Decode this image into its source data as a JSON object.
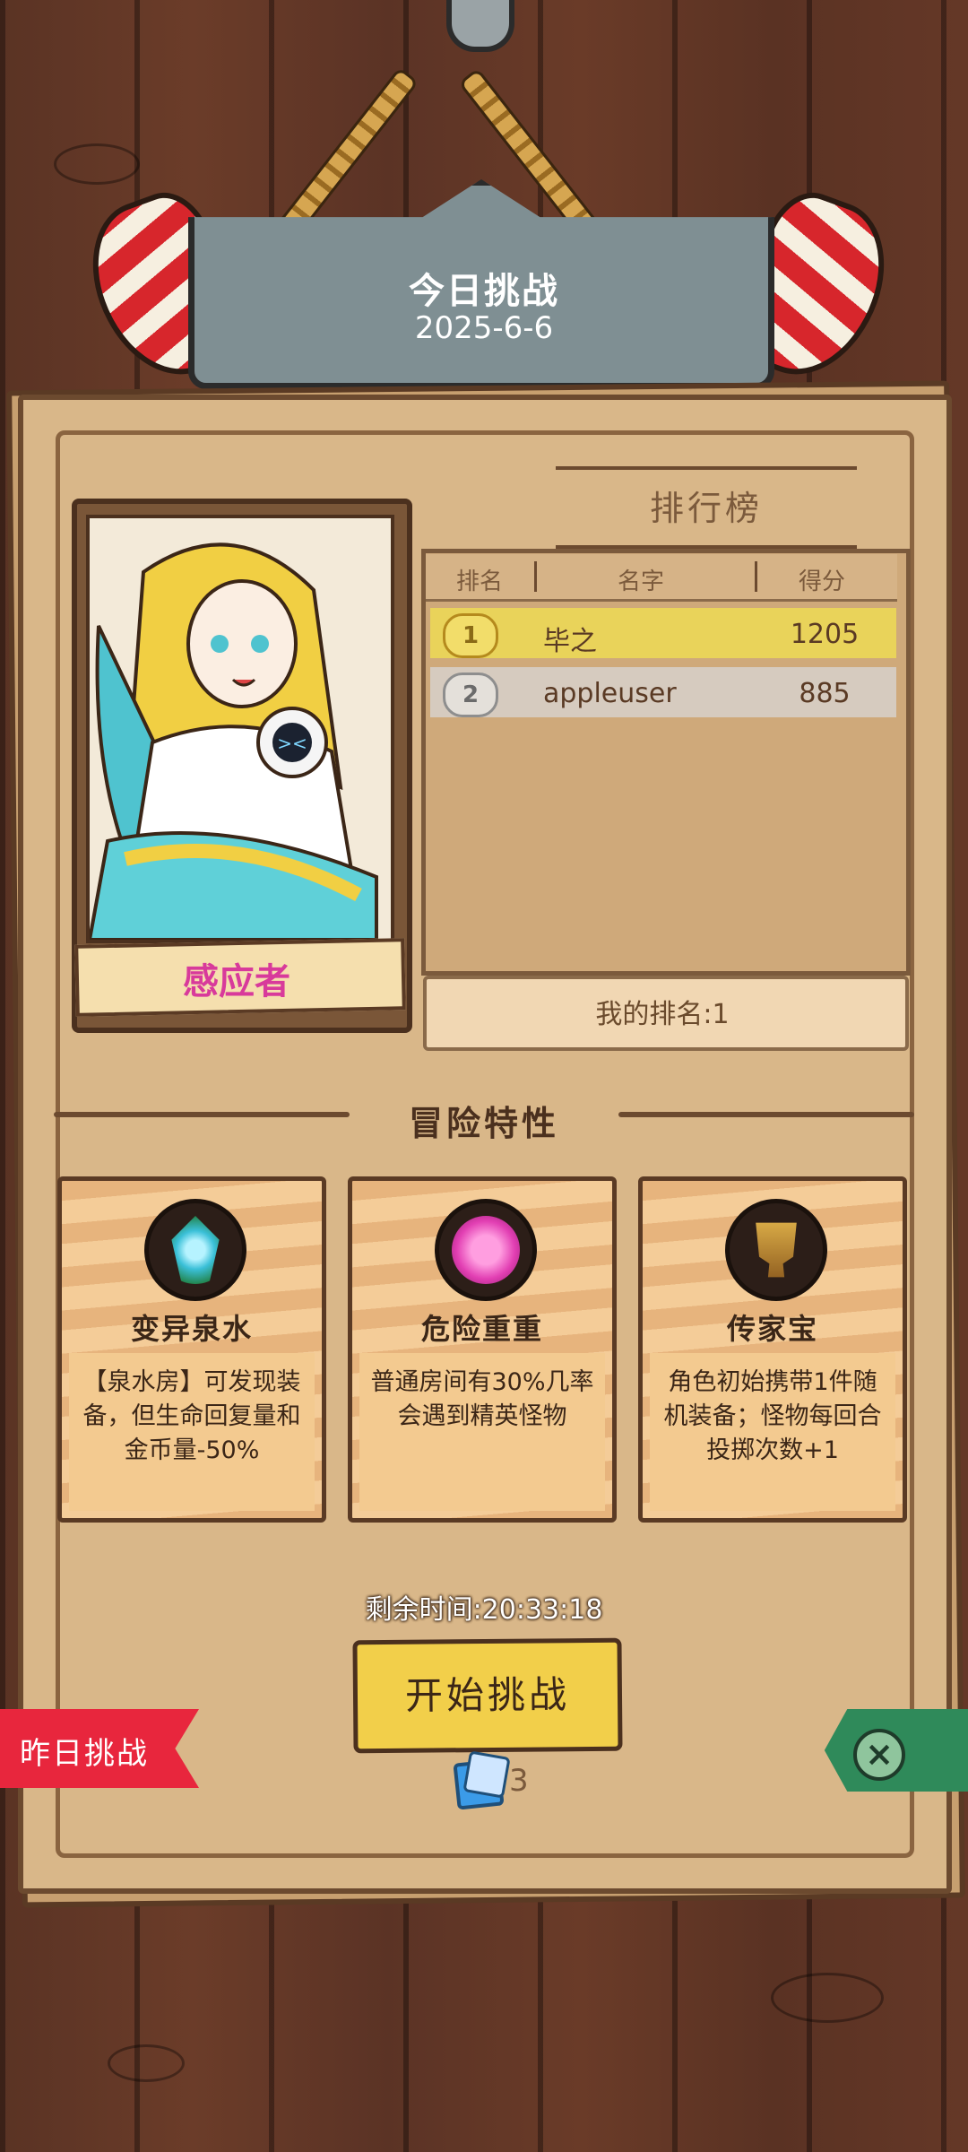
{
  "header": {
    "title": "今日挑战",
    "date": "2025-6-6"
  },
  "character": {
    "name": "感应者"
  },
  "leaderboard": {
    "title": "排行榜",
    "columns": [
      "排名",
      "名字",
      "得分"
    ],
    "rows": [
      {
        "rank": "1",
        "name": "毕之",
        "score": "1205"
      },
      {
        "rank": "2",
        "name": "appleuser",
        "score": "885"
      }
    ],
    "my_rank": "我的排名:1"
  },
  "traits": {
    "title": "冒险特性",
    "items": [
      {
        "name": "变异泉水",
        "desc": "【泉水房】可发现装备，但生命回复量和金币量-50%",
        "icon": "crystal-icon"
      },
      {
        "name": "危险重重",
        "desc": "普通房间有30%几率会遇到精英怪物",
        "icon": "demon-face-icon"
      },
      {
        "name": "传家宝",
        "desc": "角色初始携带1件随机装备；怪物每回合投掷次数+1",
        "icon": "trophy-barrel-icon"
      }
    ]
  },
  "footer": {
    "timer": "剩余时间:20:33:18",
    "start_label": "开始挑战",
    "ticket_count": "3",
    "yesterday_label": "昨日挑战"
  },
  "colors": {
    "rank1_bg": "#e9d35a",
    "rank2_bg": "#d6cbbf",
    "accent_start": "#f2cf4a",
    "yesterday_tab": "#e8263d",
    "close_tab": "#2f8a5a",
    "character_name": "#d83a9b"
  }
}
